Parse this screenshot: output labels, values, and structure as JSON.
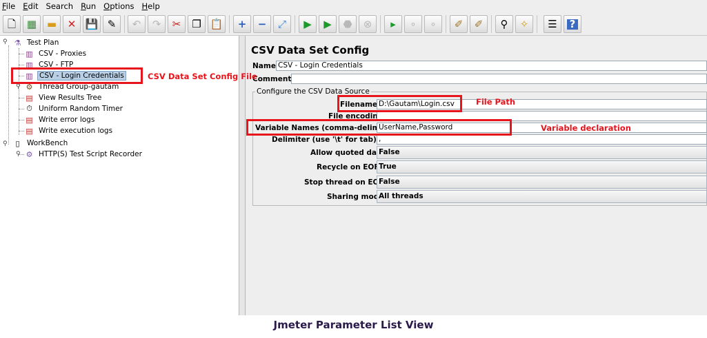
{
  "menu": {
    "items": [
      "File",
      "Edit",
      "Search",
      "Run",
      "Options",
      "Help"
    ]
  },
  "toolbar": {
    "buttons": [
      {
        "icon": "new-icon"
      },
      {
        "icon": "templates-icon"
      },
      {
        "icon": "open-icon"
      },
      {
        "icon": "close-icon"
      },
      {
        "icon": "save-icon"
      },
      {
        "icon": "save-as-icon"
      },
      {
        "icon": "undo-icon"
      },
      {
        "icon": "redo-icon"
      },
      {
        "icon": "cut-icon"
      },
      {
        "icon": "copy-icon"
      },
      {
        "icon": "paste-icon"
      },
      {
        "icon": "expand-icon"
      },
      {
        "icon": "collapse-icon"
      },
      {
        "icon": "toggle-icon"
      },
      {
        "icon": "start-icon"
      },
      {
        "icon": "start-no-pauses-icon"
      },
      {
        "icon": "stop-icon"
      },
      {
        "icon": "shutdown-icon"
      },
      {
        "icon": "remote-start-icon"
      },
      {
        "icon": "remote-stop-icon"
      },
      {
        "icon": "remote-shutdown-icon"
      },
      {
        "icon": "clear-icon"
      },
      {
        "icon": "clear-all-icon"
      },
      {
        "icon": "search-icon"
      },
      {
        "icon": "reset-search-icon"
      },
      {
        "icon": "function-helper-icon"
      },
      {
        "icon": "help-icon"
      }
    ]
  },
  "tree": {
    "test_plan": "Test Plan",
    "items": [
      {
        "label": "CSV - Proxies",
        "icon": "config-element-icon"
      },
      {
        "label": "CSV - FTP",
        "icon": "config-element-icon"
      },
      {
        "label": "CSV - Login Credentials",
        "icon": "config-element-icon"
      },
      {
        "label": "Thread Group-gautam",
        "icon": "thread-group-icon"
      },
      {
        "label": "View Results Tree",
        "icon": "listener-icon"
      },
      {
        "label": "Uniform Random Timer",
        "icon": "timer-icon"
      },
      {
        "label": "Write error logs",
        "icon": "listener-icon"
      },
      {
        "label": "Write execution logs",
        "icon": "listener-icon"
      }
    ],
    "workbench": "WorkBench",
    "recorder": "HTTP(S) Test Script Recorder"
  },
  "panel": {
    "title": "CSV Data Set Config",
    "name_label": "Name:",
    "name_value": "CSV - Login Credentials",
    "comments_label": "Comments:",
    "group_title": "Configure the CSV Data Source",
    "filename_label": "Filename:",
    "filename_value": "D:\\Gautam\\Login.csv",
    "encoding_label": "File encoding:",
    "encoding_value": "",
    "varnames_label": "Variable Names (comma-delimited):",
    "varnames_value": "UserName,Password",
    "delimiter_label": "Delimiter (use '\\t' for tab):",
    "delimiter_value": ",",
    "quoted_label": "Allow quoted data?:",
    "quoted_value": "False",
    "recycle_label": "Recycle on EOF ?:",
    "recycle_value": "True",
    "stop_label": "Stop thread on EOF ?:",
    "stop_value": "False",
    "sharing_label": "Sharing mode:",
    "sharing_value": "All threads"
  },
  "annotations": {
    "config_file": "CSV Data Set Config File",
    "file_path": "File Path",
    "variable_declaration": "Variable declaration",
    "color": "#e8141c"
  },
  "caption": "Jmeter Parameter List View"
}
